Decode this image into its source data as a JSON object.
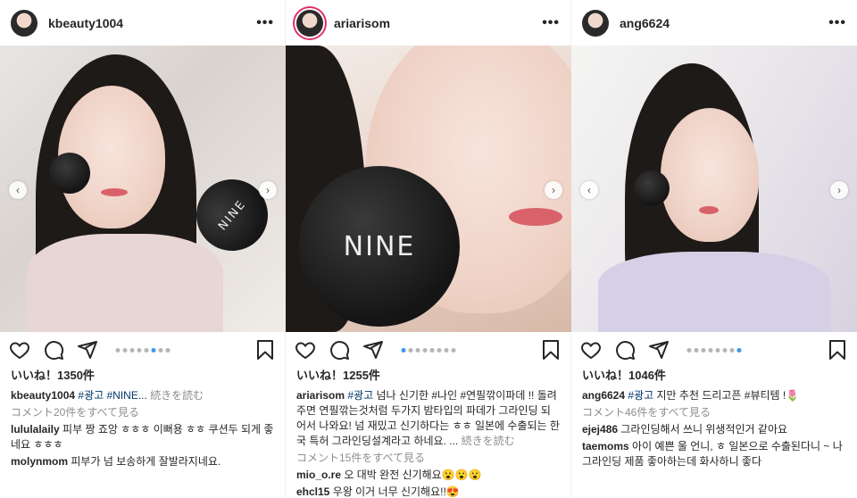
{
  "posts": [
    {
      "username": "kbeauty1004",
      "likes": "いいね！1350件",
      "caption_user": "kbeauty1004",
      "caption_tags": "#광고 #NINE...",
      "caption_text": "",
      "caption_more": "続きを読む",
      "view_comments": "コメント20件をすべて見る",
      "comments": [
        {
          "user": "lululalaily",
          "text": "피부 짱 죠앙 ㅎㅎㅎ 이뻐용 ㅎㅎ 쿠션두 되게 좋네요 ㅎㅎㅎ"
        },
        {
          "user": "molynmom",
          "text": "피부가 넘 보송하게 잘발라지네요."
        }
      ],
      "carousel_active": 5,
      "carousel_count": 8,
      "has_left": true,
      "has_right": true
    },
    {
      "username": "ariarisom",
      "likes": "いいね！1255件",
      "caption_user": "ariarisom",
      "caption_tags": "#광고",
      "caption_text": "넘나 신기한 #나인 #연필깎이파데 !! 돌려주면 연필깎는것처럼 두가지 밤타입의 파데가 그라인딩 되어서 나와요! 넘 재밌고 신기하다는 ㅎㅎ 일본에 수출되는 한국 특허 그라인딩설계라고 하네요. ...",
      "caption_more": "続きを読む",
      "view_comments": "コメント15件をすべて見る",
      "comments": [
        {
          "user": "mio_o.re",
          "text": "오 대박 완전 신기해요😮😮😮"
        },
        {
          "user": "ehcl15",
          "text": "우왕 이거 너무 신기해요!!😍"
        }
      ],
      "carousel_active": 0,
      "carousel_count": 8,
      "has_left": false,
      "has_right": true
    },
    {
      "username": "ang6624",
      "likes": "いいね！1046件",
      "caption_user": "ang6624",
      "caption_tags": "#광고",
      "caption_text": "지만 추천 드리고픈 #뷰티템 !🌷",
      "caption_more": "",
      "view_comments": "コメント46件をすべて見る",
      "comments": [
        {
          "user": "ejej486",
          "text": "그라인딩해서 쓰니 위생적인거 같아요"
        },
        {
          "user": "taemoms",
          "text": "아이 예쁜 울 언니, ㅎ 일본으로 수출된다니 ~ 나 그라인딩 제품 좋아하는데 화사하니 좋다"
        }
      ],
      "carousel_active": 7,
      "carousel_count": 8,
      "has_left": true,
      "has_right": true
    }
  ],
  "brand_text": "NINE",
  "colors": {
    "accent": "#3897f0",
    "tag": "#00376b",
    "muted": "#8e8e8e"
  },
  "icons": [
    "more-icon",
    "heart-icon",
    "comment-icon",
    "share-icon",
    "bookmark-icon",
    "chevron-left-icon",
    "chevron-right-icon"
  ]
}
